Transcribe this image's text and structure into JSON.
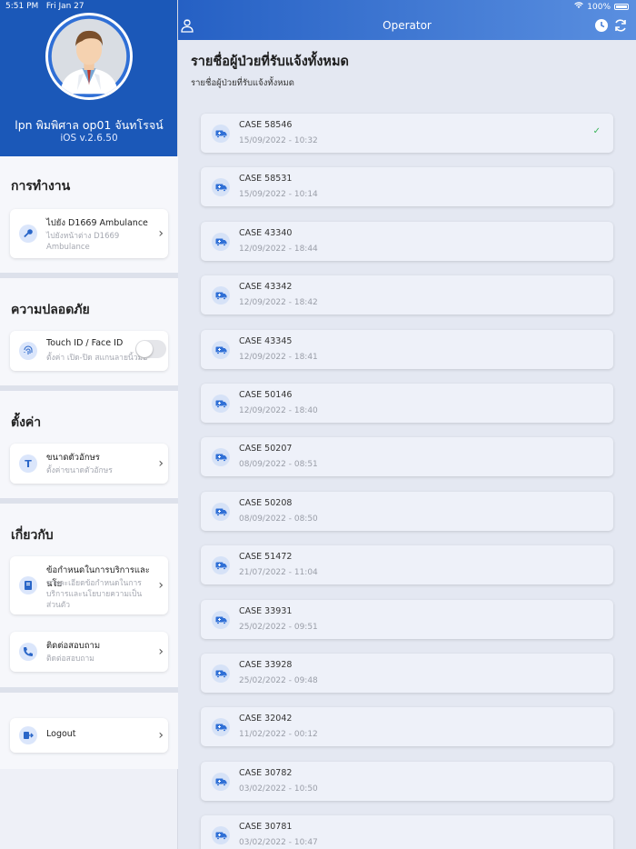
{
  "status": {
    "time": "5:51 PM",
    "date": "Fri Jan 27",
    "battery": "100%"
  },
  "profile": {
    "name": "lpn พิมพิศาล op01 จันทโรจน์",
    "version": "iOS v.2.6.50"
  },
  "sections": {
    "work": {
      "title": "การทำงาน",
      "item": {
        "title": "ไปยัง D1669 Ambulance",
        "subtitle": "ไปยังหน้าต่าง D1669 Ambulance",
        "icon": "key-icon"
      }
    },
    "security": {
      "title": "ความปลอดภัย",
      "item": {
        "title": "Touch ID / Face ID",
        "subtitle": "ตั้งค่า เปิด-ปิด สแกนลายนิ้วมือ",
        "icon": "fingerprint-icon",
        "enabled": false
      }
    },
    "settings": {
      "title": "ตั้งค่า",
      "item": {
        "title": "ขนาดตัวอักษร",
        "subtitle": "ตั้งค่าขนาดตัวอักษร",
        "icon": "text-size-icon",
        "icon_glyph": "T"
      }
    },
    "about": {
      "title": "เกี่ยวกับ",
      "items": [
        {
          "title": "ข้อกำหนดในการบริการและนโย",
          "subtitle": "รายละเอียดข้อกำหนดในการบริการและนโยบายความเป็นส่วนตัว",
          "icon": "book-icon"
        },
        {
          "title": "ติดต่อสอบถาม",
          "subtitle": "ติดต่อสอบถาม",
          "icon": "phone-icon"
        }
      ]
    },
    "logout": {
      "label": "Logout",
      "icon": "logout-icon"
    }
  },
  "topbar": {
    "title": "Operator",
    "left_icon": "user-nurse-icon",
    "right_icons": [
      "history-icon",
      "refresh-icon"
    ]
  },
  "main": {
    "title": "รายชื่อผู้ป่วยที่รับแจ้งทั้งหมด",
    "subtitle": "รายชื่อผู้ป่วยที่รับแจ้งทั้งหมด",
    "cases": [
      {
        "title": "CASE 58546",
        "date": "15/09/2022 - 10:32",
        "checked": true
      },
      {
        "title": "CASE 58531",
        "date": "15/09/2022 - 10:14",
        "checked": false
      },
      {
        "title": "CASE 43340",
        "date": "12/09/2022 - 18:44",
        "checked": false
      },
      {
        "title": "CASE 43342",
        "date": "12/09/2022 - 18:42",
        "checked": false
      },
      {
        "title": "CASE 43345",
        "date": "12/09/2022 - 18:41",
        "checked": false
      },
      {
        "title": "CASE 50146",
        "date": "12/09/2022 - 18:40",
        "checked": false
      },
      {
        "title": "CASE 50207",
        "date": "08/09/2022 - 08:51",
        "checked": false
      },
      {
        "title": "CASE 50208",
        "date": "08/09/2022 - 08:50",
        "checked": false
      },
      {
        "title": "CASE 51472",
        "date": "21/07/2022 - 11:04",
        "checked": false
      },
      {
        "title": "CASE 33931",
        "date": "25/02/2022 - 09:51",
        "checked": false
      },
      {
        "title": "CASE 33928",
        "date": "25/02/2022 - 09:48",
        "checked": false
      },
      {
        "title": "CASE 32042",
        "date": "11/02/2022 - 00:12",
        "checked": false
      },
      {
        "title": "CASE 30782",
        "date": "03/02/2022 - 10:50",
        "checked": false
      },
      {
        "title": "CASE 30781",
        "date": "03/02/2022 - 10:47",
        "checked": false
      }
    ]
  },
  "colors": {
    "primary": "#1b58b8",
    "accent": "#5a8fe0",
    "check": "#3cb55a"
  }
}
